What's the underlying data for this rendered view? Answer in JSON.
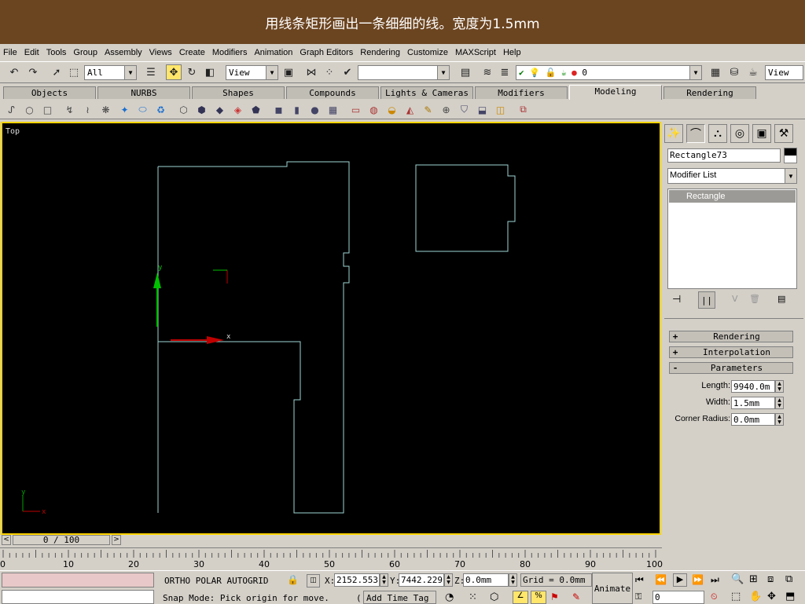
{
  "caption": "用线条矩形画出一条细细的线。宽度为1.5mm",
  "menu": [
    "File",
    "Edit",
    "Tools",
    "Group",
    "Assembly",
    "Views",
    "Create",
    "Modifiers",
    "Animation",
    "Graph Editors",
    "Rendering",
    "Customize",
    "MAXScript",
    "Help"
  ],
  "toolbar": {
    "selection_filter": "All",
    "reference_coord": "View",
    "named_selection": "",
    "layer_value": "0",
    "right_view": "View"
  },
  "tabs": [
    "Objects",
    "NURBS",
    "Shapes",
    "Compounds",
    "Lights & Cameras",
    "Modifiers",
    "Modeling",
    "Rendering"
  ],
  "active_tab": "Modeling",
  "viewport": {
    "label": "Top",
    "gizmo_x": "x",
    "gizmo_y": "y",
    "axis_x": "x",
    "axis_y": "y"
  },
  "panel": {
    "object_name": "Rectangle73",
    "modifier_list": "Modifier List",
    "stack_item": "Rectangle",
    "rollouts": [
      {
        "sign": "+",
        "label": "Rendering"
      },
      {
        "sign": "+",
        "label": "Interpolation"
      },
      {
        "sign": "-",
        "label": "Parameters"
      }
    ],
    "params": {
      "length_label": "Length:",
      "length_value": "9940.0m",
      "width_label": "Width:",
      "width_value": "1.5mm",
      "corner_label": "Corner Radius:",
      "corner_value": "0.0mm"
    }
  },
  "time": {
    "slider": "0 / 100",
    "ticks": [
      "0",
      "10",
      "20",
      "30",
      "40",
      "50",
      "60",
      "70",
      "80",
      "90",
      "100"
    ]
  },
  "status": {
    "modes": "ORTHO  POLAR  AUTOGRID",
    "x_label": "X:",
    "x_value": "2152.553",
    "y_label": "Y:",
    "y_value": "7442.229",
    "z_label": "Z:",
    "z_value": "0.0mm",
    "grid": "Grid = 0.0mm",
    "prompt": "Snap Mode: Pick origin for move.",
    "add_time_tag": "Add Time Tag",
    "animate": "Animate",
    "frame": "0"
  },
  "colors": {
    "title_bg": "#6b4420",
    "viewport_border": "#ffd400",
    "shape_line": "#9ed6d4"
  }
}
